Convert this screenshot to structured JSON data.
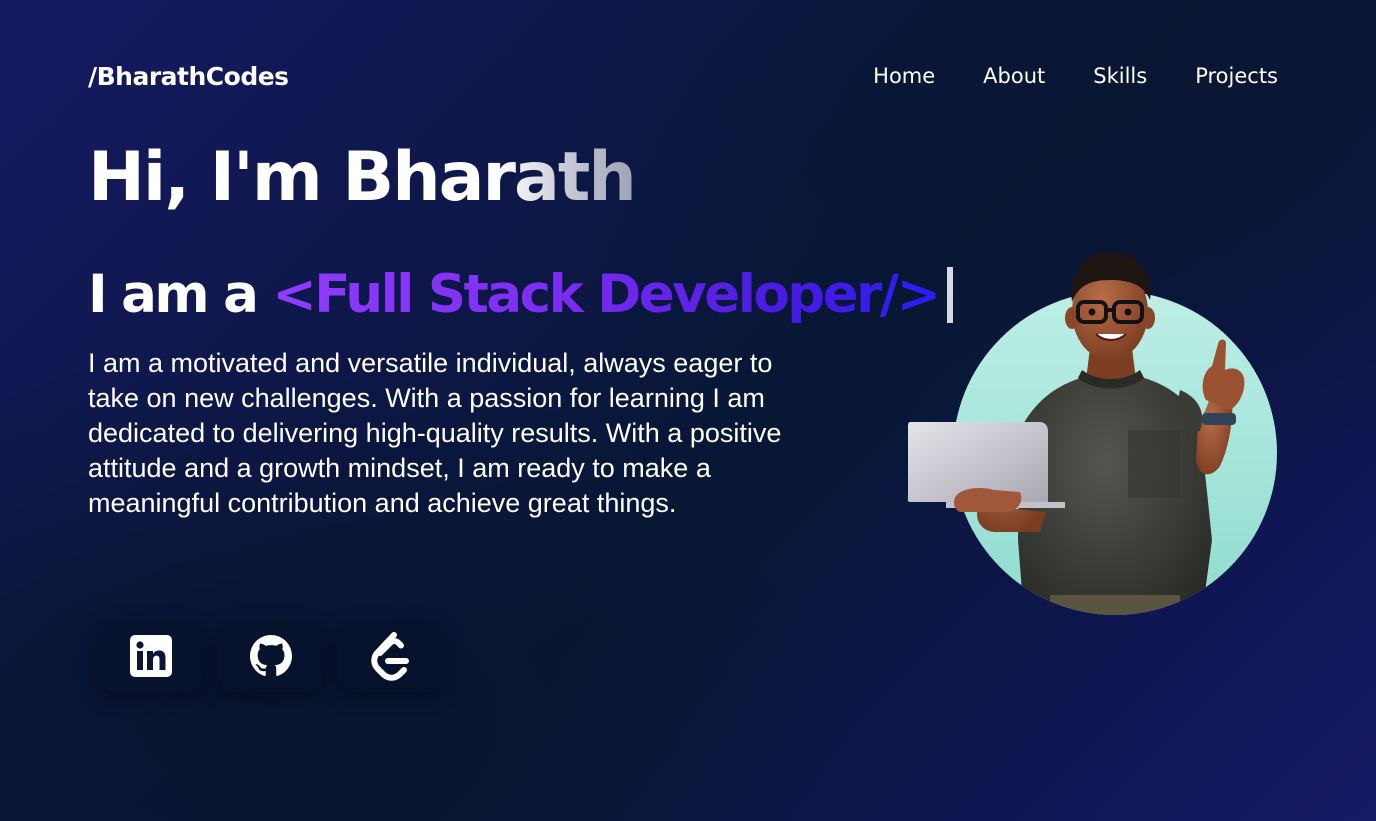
{
  "header": {
    "logo": "/BharathCodes",
    "nav": [
      {
        "label": "Home"
      },
      {
        "label": "About"
      },
      {
        "label": "Skills"
      },
      {
        "label": "Projects"
      }
    ]
  },
  "hero": {
    "title": "Hi, I'm Bharath",
    "tagline_prefix": "I am a",
    "tagline_role": "<Full Stack Developer/>",
    "intro": "I am a motivated and versatile individual, always eager to take on new challenges. With a passion for learning I am dedicated to delivering high-quality results. With a positive attitude and a growth mindset, I am ready to make a meaningful contribution and achieve great things."
  },
  "socials": [
    {
      "icon": "linkedin-icon"
    },
    {
      "icon": "github-icon"
    },
    {
      "icon": "leetcode-icon"
    }
  ],
  "colors": {
    "background": "#0d1746",
    "accent_start": "#8f3dff",
    "accent_end": "#2d1cf2",
    "avatar_circle": "#a8e6dc"
  }
}
